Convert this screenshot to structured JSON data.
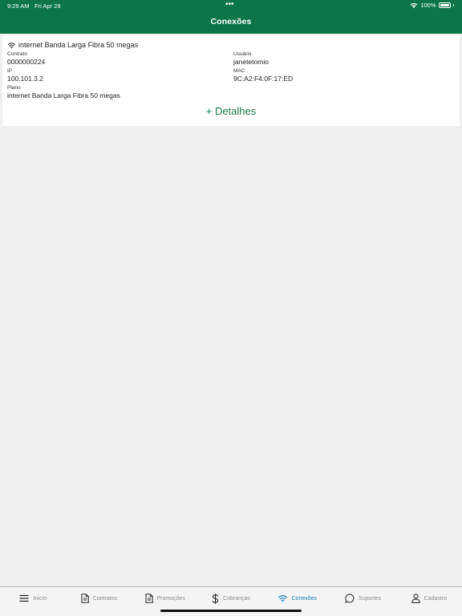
{
  "status_bar": {
    "time": "9:29 AM",
    "date": "Fri Apr 28",
    "dots": "•••",
    "battery": "100%",
    "battery_level": 1.0
  },
  "header": {
    "title": "Conexões"
  },
  "connection": {
    "title": "internet Banda Larga Fibra 50 megas",
    "contract_label": "Contrato",
    "contract_value": "0000000224",
    "user_label": "Usuário",
    "user_value": "janetetomio",
    "ip_label": "IP",
    "ip_value": "100.101.3.2",
    "mac_label": "MAC",
    "mac_value": "9C:A2:F4:0F:17:ED",
    "plan_label": "Plano",
    "plan_value": "internet Banda Larga Fibra 50 megas",
    "details_link": "+ Detalhes"
  },
  "tabs": [
    {
      "label": "Início",
      "icon": "menu-icon",
      "active": false
    },
    {
      "label": "Contratos",
      "icon": "document-icon",
      "active": false
    },
    {
      "label": "Promoções",
      "icon": "document-icon",
      "active": false
    },
    {
      "label": "Cobranças",
      "icon": "dollar-icon",
      "active": false
    },
    {
      "label": "Conexões",
      "icon": "wifi-icon",
      "active": true
    },
    {
      "label": "Suportes",
      "icon": "chat-icon",
      "active": false
    },
    {
      "label": "Cadastro",
      "icon": "person-icon",
      "active": false
    }
  ],
  "colors": {
    "header": "#0c7649",
    "accent": "#17794d",
    "active_tab": "#1780b8",
    "inactive_tab": "#8a8a8a",
    "background": "#efefef"
  }
}
